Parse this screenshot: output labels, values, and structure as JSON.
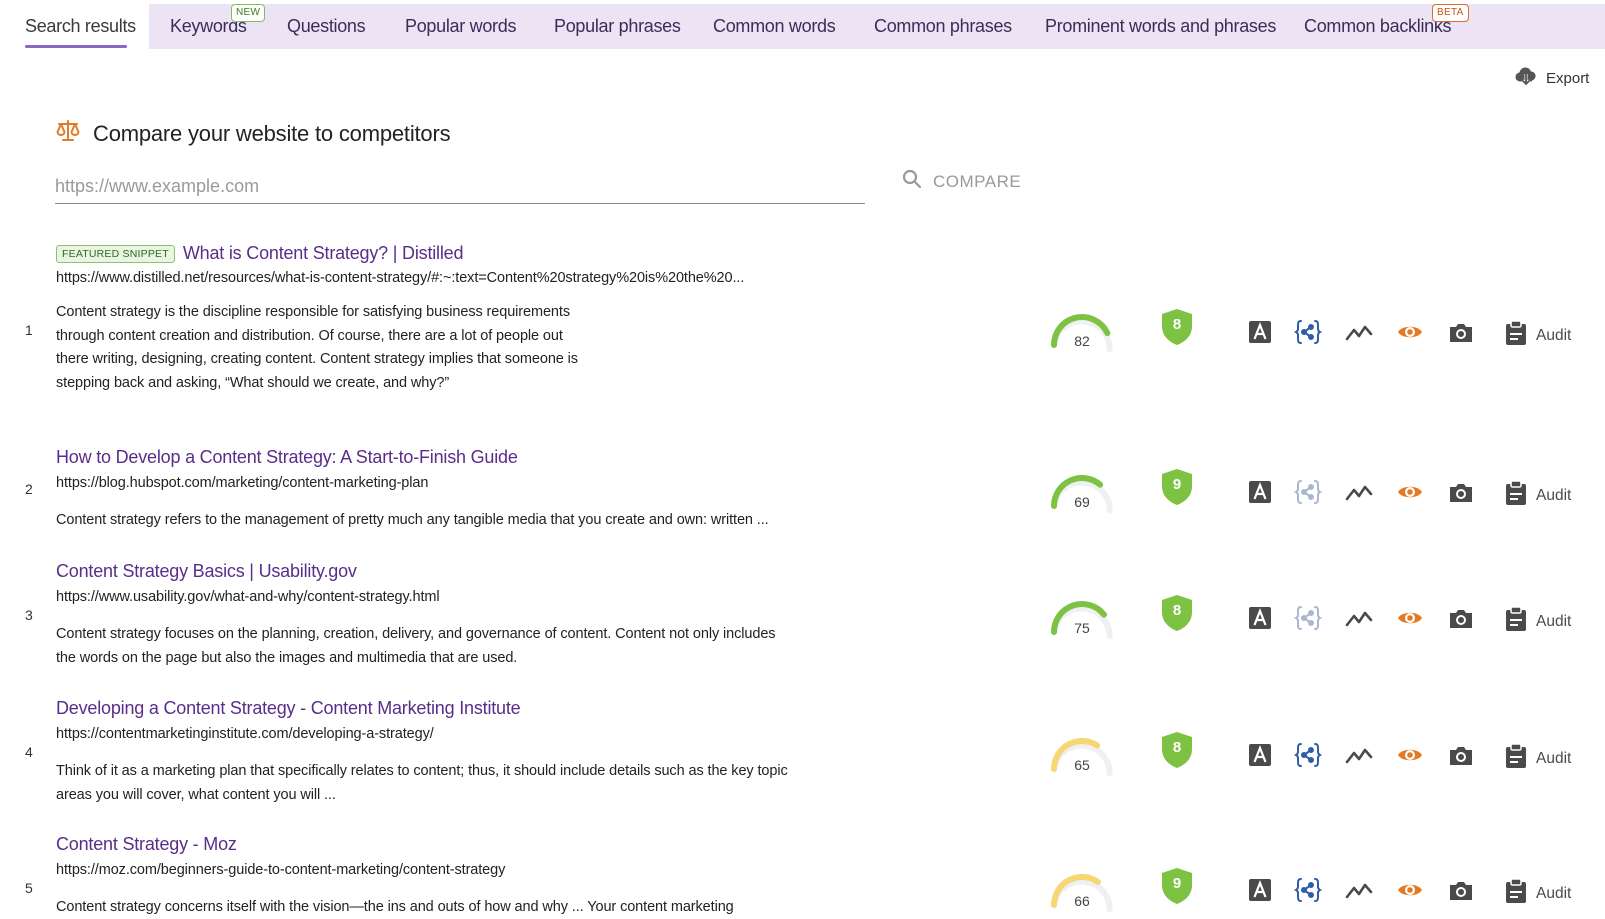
{
  "tabs": [
    {
      "label": "Search results",
      "active": true
    },
    {
      "label": "Keywords",
      "badge": "NEW"
    },
    {
      "label": "Questions"
    },
    {
      "label": "Popular words"
    },
    {
      "label": "Popular phrases"
    },
    {
      "label": "Common words"
    },
    {
      "label": "Common phrases"
    },
    {
      "label": "Prominent words and phrases"
    },
    {
      "label": "Common backlinks",
      "badge": "BETA"
    }
  ],
  "export_label": "Export",
  "compare": {
    "title": "Compare your website to competitors",
    "placeholder": "https://www.example.com",
    "button_label": "COMPARE"
  },
  "colors": {
    "tab_bg": "#ece4f4",
    "accent_purple": "#5a2d8a",
    "score_green": "#7dc242",
    "score_yellow": "#f7d774",
    "eye_orange": "#e57a25",
    "icon_gray": "#4a4a4a",
    "schema_blue": "#2f5ea8"
  },
  "results": [
    {
      "rank": "1",
      "featured": "FEATURED SNIPPET",
      "title": "What is Content Strategy? | Distilled",
      "url": "https://www.distilled.net/resources/what-is-content-strategy/#:~:text=Content%20strategy%20is%20the%20...",
      "description": "Content strategy is the discipline responsible for satisfying business requirements through content creation and distribution. Of course, there are a lot of people out there writing, designing, creating content. Content strategy implies that someone is stepping back and asking, “What should we create, and why?”",
      "score": 82,
      "score_color": "green",
      "shield": "8",
      "schema_active": true,
      "audit_label": "Audit"
    },
    {
      "rank": "2",
      "title": "How to Develop a Content Strategy: A Start-to-Finish Guide",
      "url": "https://blog.hubspot.com/marketing/content-marketing-plan",
      "description": "Content strategy refers to the management of pretty much any tangible media that you create and own: written ...",
      "score": 69,
      "score_color": "green",
      "shield": "9",
      "schema_active": false,
      "audit_label": "Audit"
    },
    {
      "rank": "3",
      "title": "Content Strategy Basics | Usability.gov",
      "url": "https://www.usability.gov/what-and-why/content-strategy.html",
      "description": "Content strategy focuses on the planning, creation, delivery, and governance of content. Content not only includes the words on the page but also the images and multimedia that are used.",
      "score": 75,
      "score_color": "green",
      "shield": "8",
      "schema_active": false,
      "audit_label": "Audit"
    },
    {
      "rank": "4",
      "title": "Developing a Content Strategy - Content Marketing Institute",
      "url": "https://contentmarketinginstitute.com/developing-a-strategy/",
      "description": "Think of it as a marketing plan that specifically relates to content; thus, it should include details such as the key topic areas you will cover, what content you will ...",
      "score": 65,
      "score_color": "yellow",
      "shield": "8",
      "schema_active": true,
      "audit_label": "Audit"
    },
    {
      "rank": "5",
      "title": "Content Strategy - Moz",
      "url": "https://moz.com/beginners-guide-to-content-marketing/content-strategy",
      "description": "Content strategy concerns itself with the vision—the ins and outs of how and why ... Your content marketing",
      "score": 66,
      "score_color": "yellow",
      "shield": "9",
      "schema_active": true,
      "audit_label": "Audit"
    }
  ],
  "icons": [
    "font-icon",
    "schema-icon",
    "trend-icon",
    "eye-icon",
    "camera-icon",
    "clipboard-icon"
  ]
}
